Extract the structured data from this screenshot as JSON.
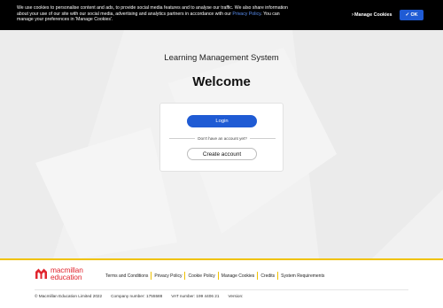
{
  "cookie_banner": {
    "text_before_link": "We use cookies to personalise content and ads, to provide social media features and to analyse our traffic. We also share information about your use of our site with our social media, advertising and analytics partners in accordance with our ",
    "privacy_link": "Privacy Policy",
    "text_after_link": ". You can manage your preferences in 'Manage Cookies'.",
    "manage_cookies_label": "Manage Cookies",
    "ok_label": "✓ OK"
  },
  "header": {
    "subtitle": "Learning Management System",
    "title": "Welcome"
  },
  "login_card": {
    "login_label": "Login",
    "no_account_text": "Don't have an account yet?",
    "create_account_label": "Create account"
  },
  "footer": {
    "brand_line1": "macmillan",
    "brand_line2": "education",
    "links": [
      "Terms and Conditions",
      "Privacy Policy",
      "Cookie Policy",
      "Manage Cookies",
      "Credits",
      "System Requirements"
    ],
    "copyright": "© Macmillan Education Limited 2022",
    "company_number": "Company number: 1755588",
    "vat_number": "VAT number: 199 4406 21",
    "version": "Version:"
  },
  "colors": {
    "primary_blue": "#1f5bd4",
    "brand_red": "#e0262f",
    "accent_yellow": "#f0c200",
    "banner_bg": "#000000"
  }
}
